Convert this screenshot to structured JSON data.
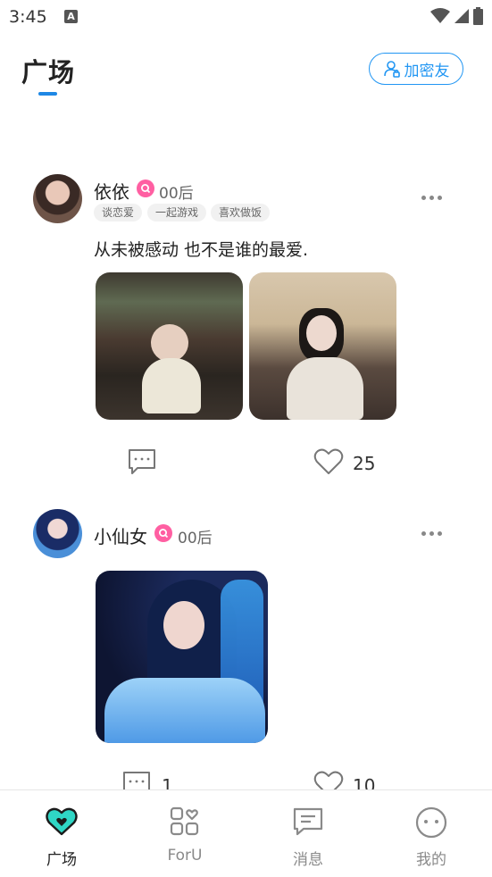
{
  "status_bar": {
    "time": "3:45",
    "notification_letter": "A"
  },
  "header": {
    "title": "广场",
    "friend_button_label": "加密友"
  },
  "posts": [
    {
      "username": "依依",
      "age_label": "00后",
      "tags": [
        "谈恋爱",
        "一起游戏",
        "喜欢做饭"
      ],
      "text": "从未被感动 也不是谁的最爱.",
      "likes": "25",
      "comments": ""
    },
    {
      "username": "小仙女",
      "age_label": "00后",
      "tags": [],
      "text": "",
      "likes": "10",
      "comments": "1"
    }
  ],
  "bottom_nav": {
    "items": [
      {
        "label": "广场",
        "icon": "heart-square-icon",
        "active": true
      },
      {
        "label": "ForU",
        "icon": "grid-heart-icon",
        "active": false
      },
      {
        "label": "消息",
        "icon": "message-icon",
        "active": false
      },
      {
        "label": "我的",
        "icon": "face-icon",
        "active": false
      }
    ]
  },
  "colors": {
    "accent": "#2196f3",
    "badge_pink": "#ff5fa2",
    "heart_teal": "#2fd6c5"
  }
}
